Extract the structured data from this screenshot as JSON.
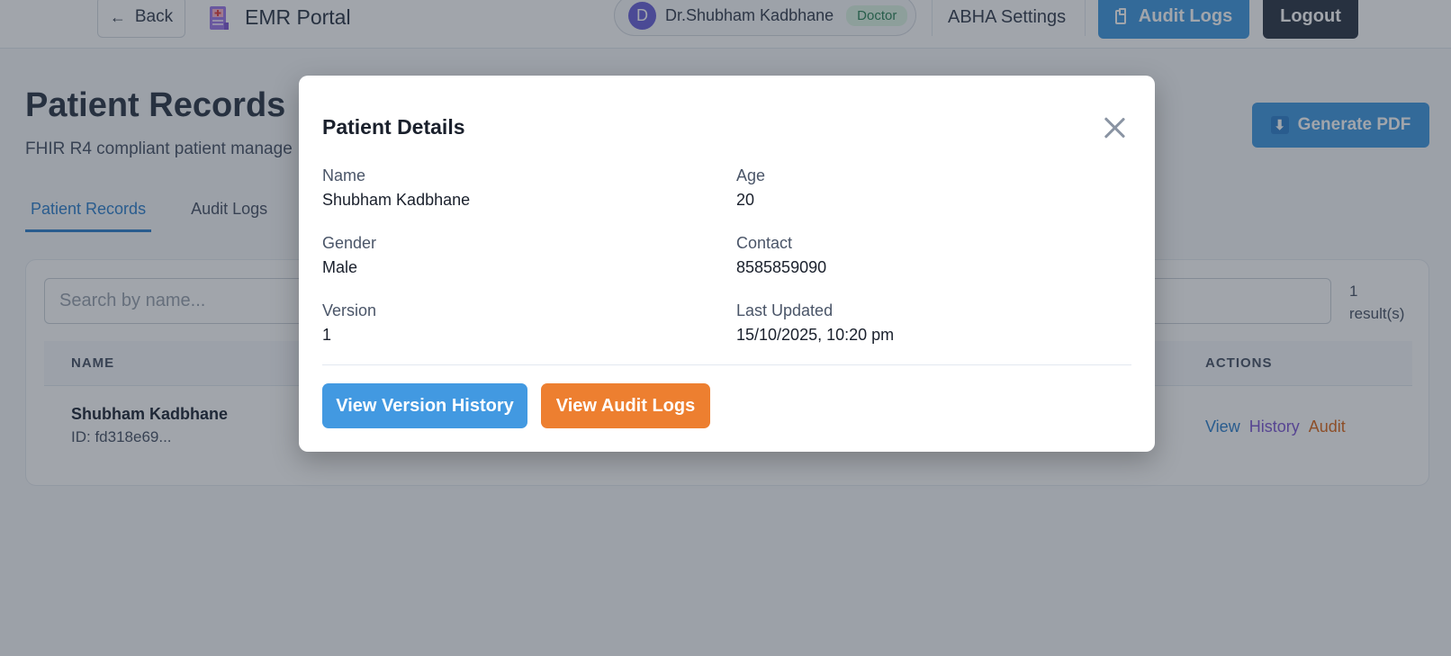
{
  "header": {
    "back_label": "Back",
    "app_title": "EMR Portal",
    "user": {
      "avatar_initial": "D",
      "name": "Dr.Shubham Kadbhane",
      "role": "Doctor"
    },
    "abha_label": "ABHA Settings",
    "audit_logs_label": "Audit Logs",
    "logout_label": "Logout"
  },
  "page": {
    "title": "Patient Records",
    "subtitle": "FHIR R4 compliant patient manage",
    "generate_pdf_label": "Generate PDF",
    "tabs": [
      {
        "label": "Patient Records",
        "active": true
      },
      {
        "label": "Audit Logs",
        "active": false
      }
    ]
  },
  "search": {
    "placeholder": "Search by name...",
    "value": "",
    "result_count": "1 result(s)"
  },
  "table": {
    "columns": {
      "name": "NAME",
      "actions": "ACTIONS"
    },
    "rows": [
      {
        "name": "Shubham Kadbhane",
        "id": "ID: fd318e69...",
        "actions": {
          "view": "View",
          "history": "History",
          "audit": "Audit"
        }
      }
    ]
  },
  "modal": {
    "title": "Patient Details",
    "fields": {
      "name": {
        "label": "Name",
        "value": "Shubham Kadbhane"
      },
      "age": {
        "label": "Age",
        "value": "20"
      },
      "gender": {
        "label": "Gender",
        "value": "Male"
      },
      "contact": {
        "label": "Contact",
        "value": "8585859090"
      },
      "version": {
        "label": "Version",
        "value": "1"
      },
      "last_updated": {
        "label": "Last Updated",
        "value": "15/10/2025, 10:20 pm"
      }
    },
    "view_version_history_label": "View Version History",
    "view_audit_logs_label": "View Audit Logs"
  },
  "colors": {
    "primary": "#4299e1",
    "dark": "#2d3748",
    "history_purple": "#805ad5",
    "audit_orange": "#ed7f30",
    "doctor_badge_green": "#2f855a"
  }
}
